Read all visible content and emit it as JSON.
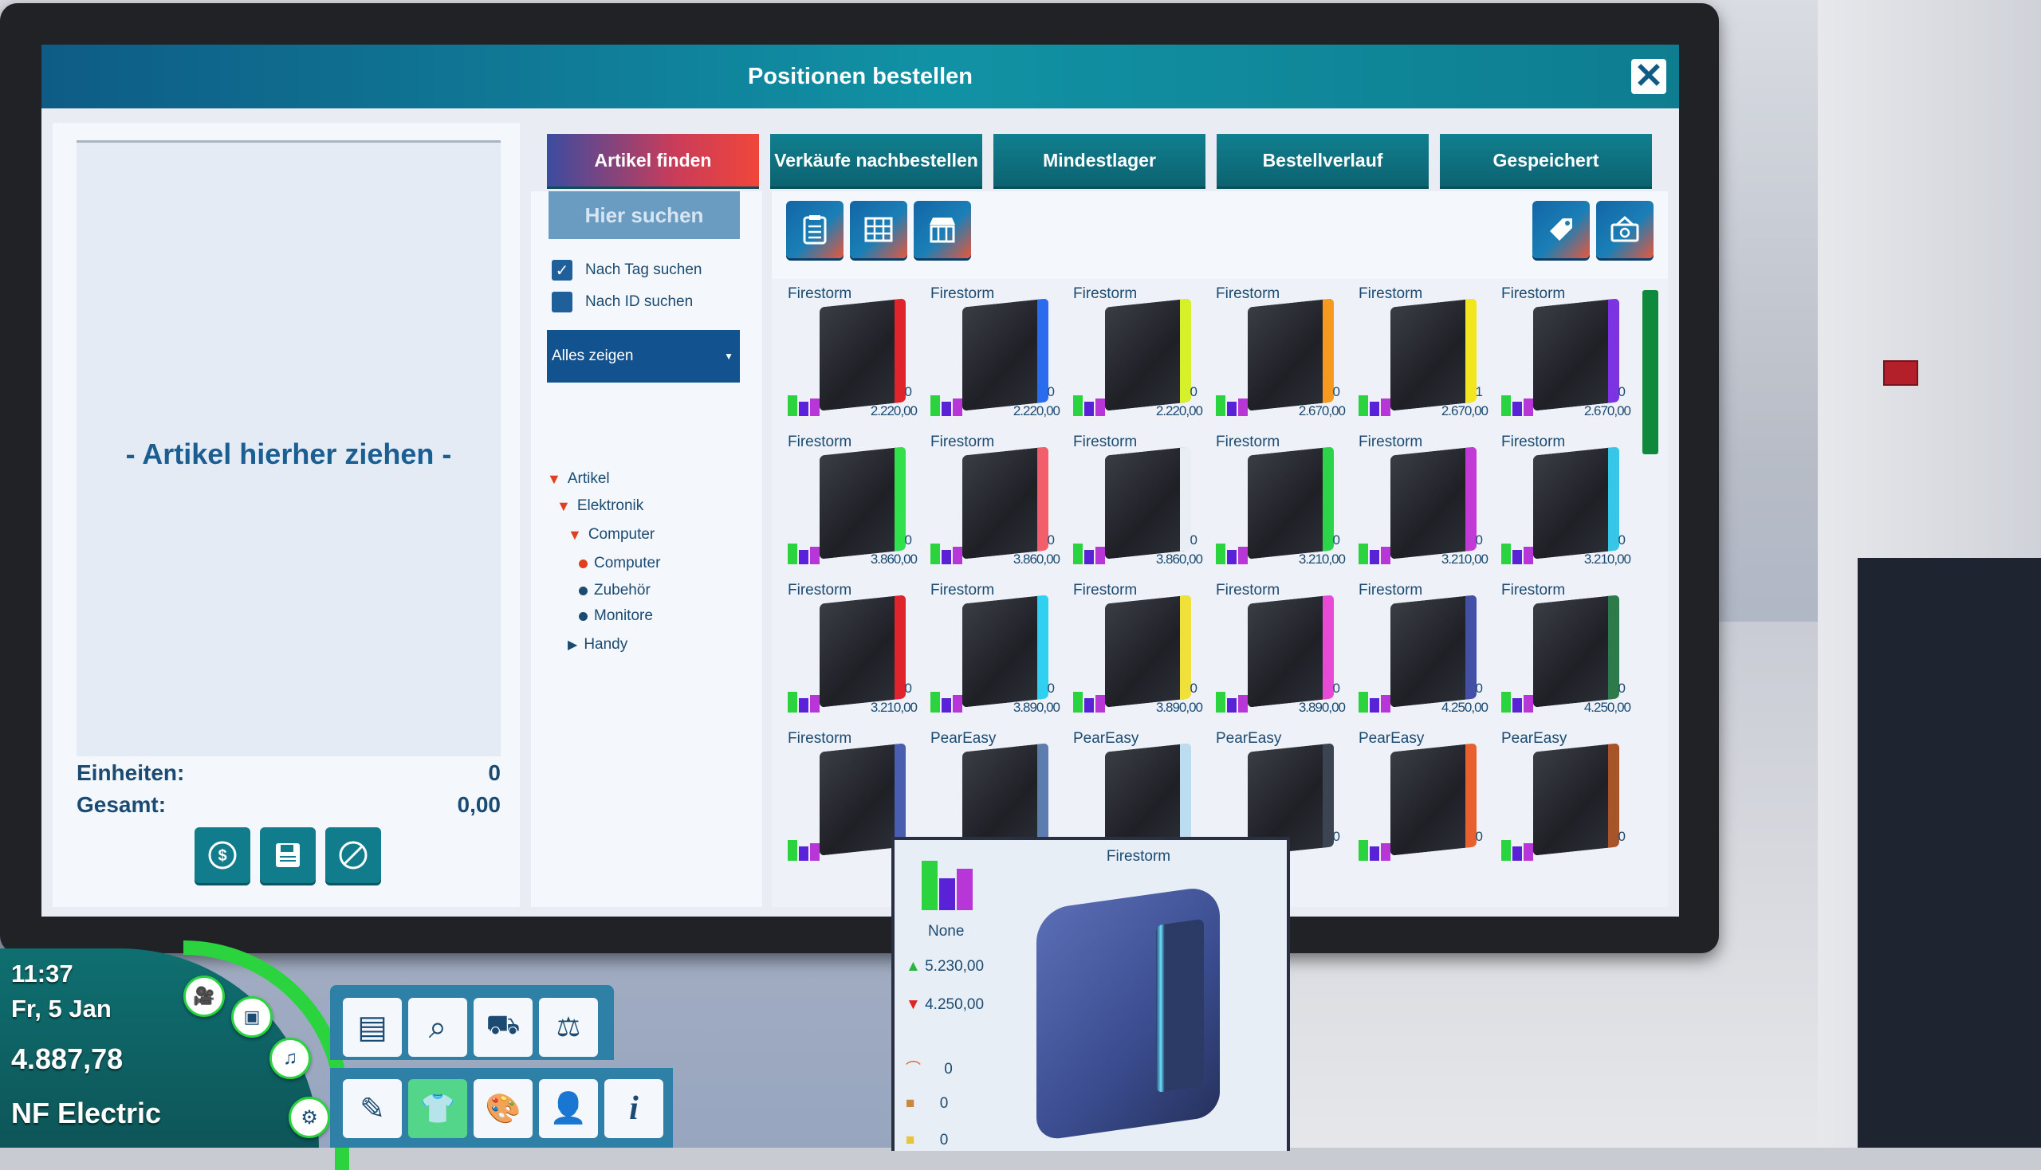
{
  "window": {
    "title": "Positionen bestellen"
  },
  "left_panel": {
    "drop_text": "- Artikel hierher ziehen -",
    "units_label": "Einheiten:",
    "units_value": "0",
    "total_label": "Gesamt:",
    "total_value": "0,00"
  },
  "tabs": [
    {
      "label": "Artikel finden"
    },
    {
      "label": "Verkäufe nachbestellen"
    },
    {
      "label": "Mindestlager"
    },
    {
      "label": "Bestellverlauf"
    },
    {
      "label": "Gespeichert"
    }
  ],
  "filter": {
    "search_label": "Hier suchen",
    "tag_search": "Nach Tag suchen",
    "id_search": "Nach ID suchen",
    "select_value": "Alles zeigen",
    "tree": {
      "articles": "Artikel",
      "electronics": "Elektronik",
      "computer_cat": "Computer",
      "computer": "Computer",
      "accessories": "Zubehör",
      "monitors": "Monitore",
      "phones": "Handy"
    }
  },
  "products": [
    {
      "name": "Firestorm",
      "stock": "0",
      "price": "2.220,00",
      "color": "#e0242b"
    },
    {
      "name": "Firestorm",
      "stock": "0",
      "price": "2.220,00",
      "color": "#2a6bf0"
    },
    {
      "name": "Firestorm",
      "stock": "0",
      "price": "2.220,00",
      "color": "#d6f02a"
    },
    {
      "name": "Firestorm",
      "stock": "0",
      "price": "2.670,00",
      "color": "#f59a1e"
    },
    {
      "name": "Firestorm",
      "stock": "1",
      "price": "2.670,00",
      "color": "#f2e61e"
    },
    {
      "name": "Firestorm",
      "stock": "0",
      "price": "2.670,00",
      "color": "#7a34e0"
    },
    {
      "name": "Firestorm",
      "stock": "0",
      "price": "3.860,00",
      "color": "#31e04a"
    },
    {
      "name": "Firestorm",
      "stock": "0",
      "price": "3.860,00",
      "color": "#f25f6a"
    },
    {
      "name": "Firestorm",
      "stock": "0",
      "price": "3.860,00",
      "color": "#e8eef4"
    },
    {
      "name": "Firestorm",
      "stock": "0",
      "price": "3.210,00",
      "color": "#2cd44a"
    },
    {
      "name": "Firestorm",
      "stock": "0",
      "price": "3.210,00",
      "color": "#c23ad6"
    },
    {
      "name": "Firestorm",
      "stock": "0",
      "price": "3.210,00",
      "color": "#38c6e6"
    },
    {
      "name": "Firestorm",
      "stock": "0",
      "price": "3.210,00",
      "color": "#e0242b"
    },
    {
      "name": "Firestorm",
      "stock": "0",
      "price": "3.890,00",
      "color": "#2fd0f0"
    },
    {
      "name": "Firestorm",
      "stock": "0",
      "price": "3.890,00",
      "color": "#f0e03a"
    },
    {
      "name": "Firestorm",
      "stock": "0",
      "price": "3.890,00",
      "color": "#e84ad6"
    },
    {
      "name": "Firestorm",
      "stock": "0",
      "price": "4.250,00",
      "color": "#4450a6"
    },
    {
      "name": "Firestorm",
      "stock": "0",
      "price": "4.250,00",
      "color": "#2f7a4a"
    },
    {
      "name": "Firestorm",
      "stock": "",
      "price": "",
      "color": "#4a5eb0"
    },
    {
      "name": "PearEasy",
      "stock": "",
      "price": "",
      "color": "#5d7dae"
    },
    {
      "name": "PearEasy",
      "stock": "",
      "price": "",
      "color": "#bcdcf0"
    },
    {
      "name": "PearEasy",
      "stock": "0",
      "price": "",
      "color": "#3c4452"
    },
    {
      "name": "PearEasy",
      "stock": "0",
      "price": "",
      "color": "#e8602e"
    },
    {
      "name": "PearEasy",
      "stock": "0",
      "price": "",
      "color": "#a8542a"
    }
  ],
  "tooltip": {
    "name": "Firestorm",
    "category": "None",
    "buy_price": "5.230,00",
    "sell_price": "4.250,00",
    "on_display": "0",
    "in_storage": "0",
    "ordered": "0"
  },
  "hud": {
    "time": "11:37",
    "date": "Fr, 5 Jan",
    "money": "4.887,78",
    "company": "NF Electric"
  },
  "colors": {
    "title_bar": "#1192a4",
    "active_tab": "#f0463a",
    "tab": "#11808f",
    "scrollbar": "#0f8a3c",
    "hud_ring": "#2bd43f"
  }
}
